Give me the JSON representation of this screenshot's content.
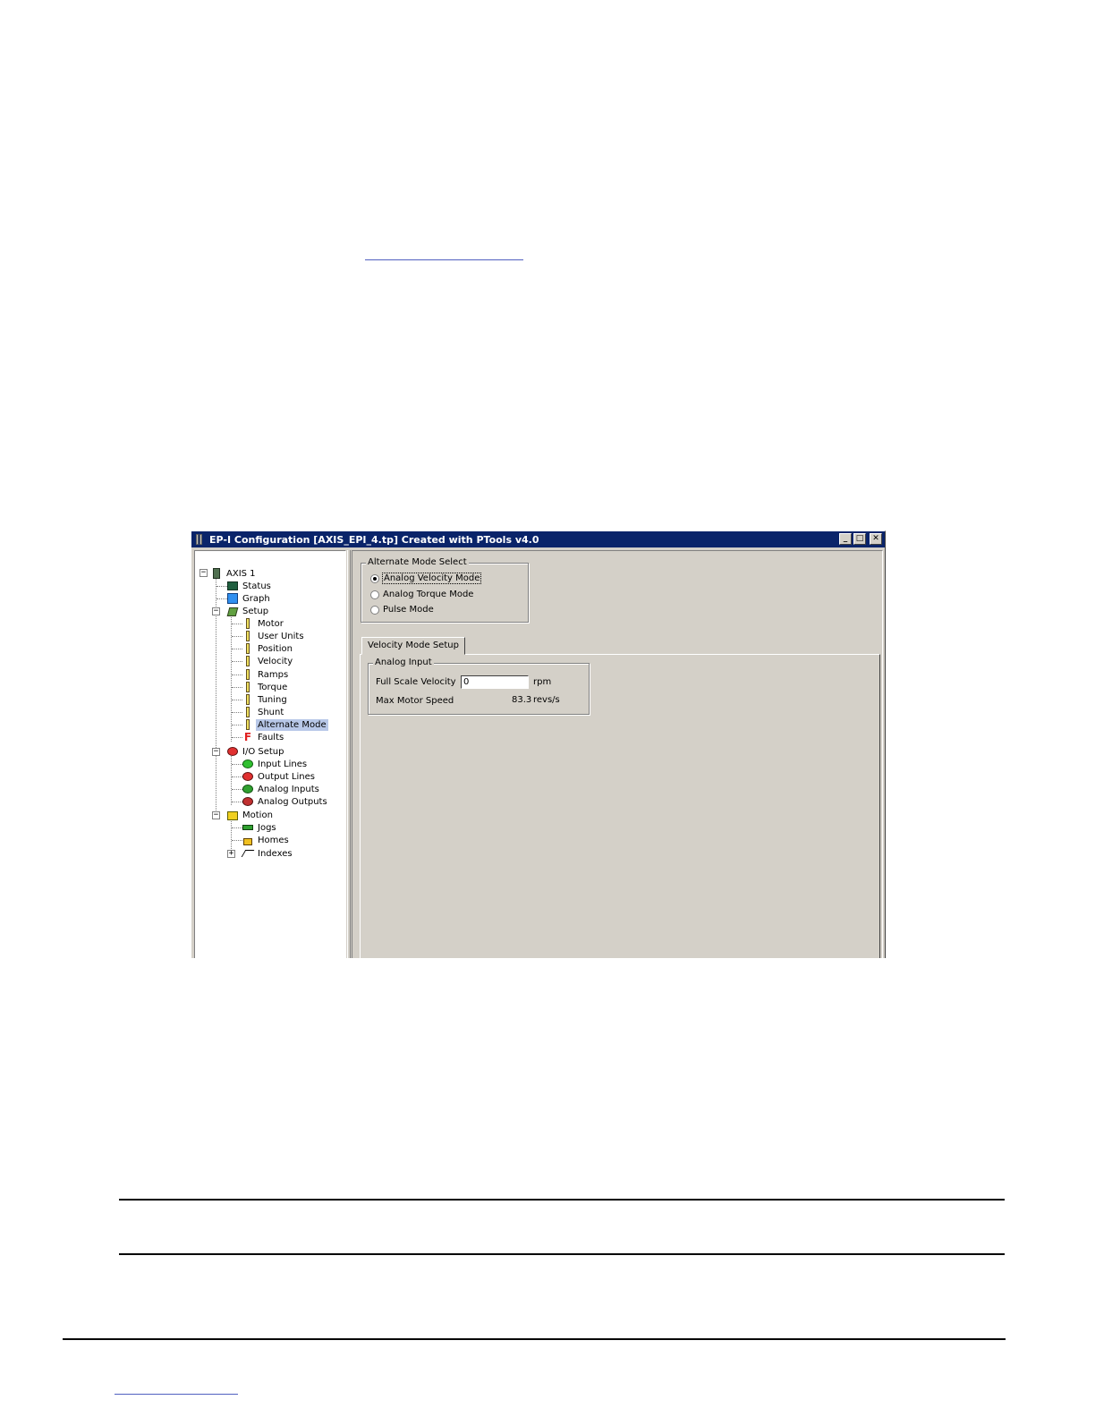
{
  "window": {
    "title": "EP-I Configuration  [AXIS_EPI_4.tp] Created with PTools v4.0",
    "buttons": {
      "minimize": "_",
      "maximize": "□",
      "close": "✕"
    }
  },
  "tree": {
    "root": "AXIS 1",
    "status": "Status",
    "graph": "Graph",
    "setup": "Setup",
    "setup_items": [
      "Motor",
      "User Units",
      "Position",
      "Velocity",
      "Ramps",
      "Torque",
      "Tuning",
      "Shunt",
      "Alternate Mode"
    ],
    "faults": "Faults",
    "io_setup": "I/O Setup",
    "io_items": [
      "Input Lines",
      "Output Lines",
      "Analog Inputs",
      "Analog Outputs"
    ],
    "motion": "Motion",
    "motion_items": [
      "Jogs",
      "Homes",
      "Indexes"
    ],
    "selected": "Alternate Mode"
  },
  "alternate_mode": {
    "title": "Alternate Mode Select",
    "options": [
      "Analog Velocity Mode",
      "Analog Torque Mode",
      "Pulse Mode"
    ],
    "selected_index": 0
  },
  "tab": {
    "label": "Velocity Mode Setup"
  },
  "analog_input": {
    "title": "Analog Input",
    "full_scale_label": "Full Scale Velocity",
    "full_scale_value": "0",
    "full_scale_unit": "rpm",
    "max_speed_label": "Max Motor Speed",
    "max_speed_value": "83.3",
    "max_speed_unit": "revs/s"
  },
  "colors": {
    "titlebar": "#0a246a",
    "face": "#d4d0c8",
    "selection": "#b8c8e8"
  }
}
